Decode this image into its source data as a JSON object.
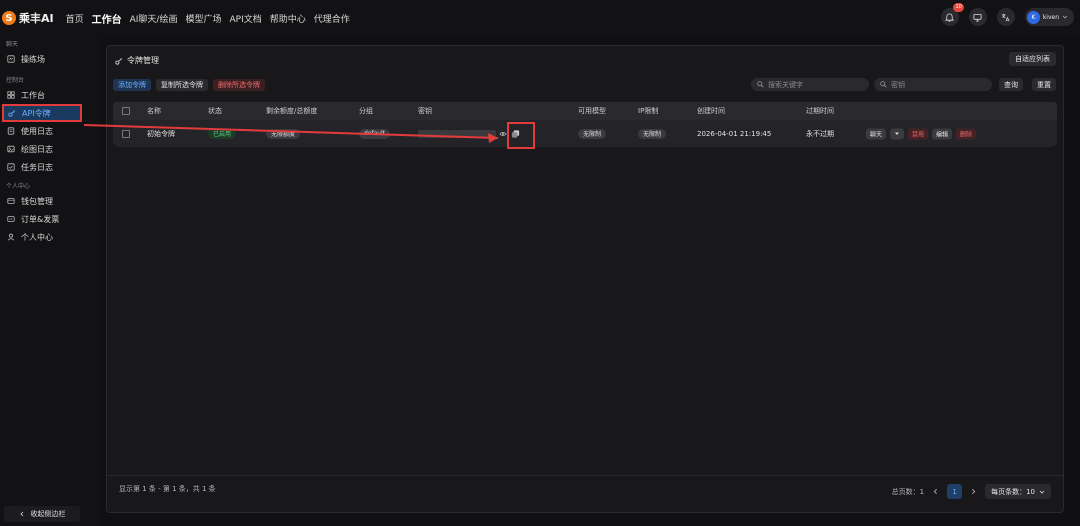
{
  "brand": {
    "name": "乘丰AI"
  },
  "nav": [
    "首页",
    "工作台",
    "AI聊天/绘画",
    "模型广场",
    "API文档",
    "帮助中心",
    "代理合作"
  ],
  "notifications": {
    "count": "10"
  },
  "user": {
    "initial": "K",
    "name": "kiven"
  },
  "sidebar": {
    "groups": [
      {
        "title": "聊天",
        "items": [
          {
            "label": "操练场",
            "icon": "playground-icon"
          }
        ]
      },
      {
        "title": "控制台",
        "items": [
          {
            "label": "工作台",
            "icon": "dashboard-icon"
          },
          {
            "label": "API令牌",
            "icon": "key-icon",
            "active": true
          },
          {
            "label": "使用日志",
            "icon": "log-icon"
          },
          {
            "label": "绘图日志",
            "icon": "image-log-icon"
          },
          {
            "label": "任务日志",
            "icon": "task-icon"
          }
        ]
      },
      {
        "title": "个人中心",
        "items": [
          {
            "label": "钱包管理",
            "icon": "wallet-icon"
          },
          {
            "label": "订单&发票",
            "icon": "invoice-icon"
          },
          {
            "label": "个人中心",
            "icon": "user-icon"
          }
        ]
      }
    ],
    "collapse_label": "收起侧边栏"
  },
  "panel": {
    "title": "令牌管理",
    "auto_columns": "自适应列表",
    "toolbar": {
      "add": "添加令牌",
      "copy": "复制所选令牌",
      "delete": "删除所选令牌"
    },
    "search_keyword_placeholder": "搜索关键字",
    "search_key_placeholder": "密钥",
    "query": "查询",
    "reset": "重置"
  },
  "table": {
    "headers": [
      "名称",
      "状态",
      "剩余额度/总额度",
      "分组",
      "密钥",
      "可用模型",
      "IP限制",
      "创建时间",
      "过期时间"
    ],
    "row": {
      "name": "初始令牌",
      "status": "已启用",
      "quota": "无限额度",
      "group": "default",
      "models": "无限制",
      "ip": "无限制",
      "created": "2026-04-01 21:19:45",
      "expires": "永不过期",
      "actions": {
        "chat": "聊天",
        "disable": "禁用",
        "edit": "编辑",
        "delete": "删除"
      }
    }
  },
  "footer": {
    "summary": "显示第 1 条 - 第 1 条，共 1 条",
    "total_pages": "总页数：1",
    "current_page": "1",
    "page_size": "每页条数：10"
  },
  "colors": {
    "accent": "#6cb0ff",
    "danger": "#ef6b6b",
    "success": "#5dd18a",
    "annotation": "#e23b3b"
  }
}
